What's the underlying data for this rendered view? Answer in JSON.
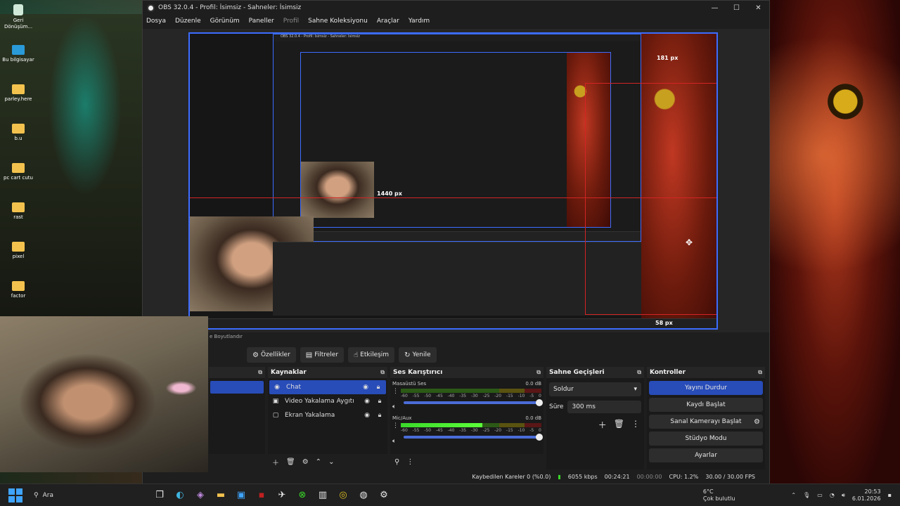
{
  "desktop": {
    "icons": [
      {
        "label": "Geri Dönüşüm...",
        "icon": "recycle-bin-icon"
      },
      {
        "label": "Bu bilgisayar",
        "icon": "computer-icon"
      },
      {
        "label": "parley.here",
        "icon": "folder-icon"
      },
      {
        "label": "b.u",
        "icon": "folder-icon"
      },
      {
        "label": "pc cart cutu",
        "icon": "folder-icon"
      },
      {
        "label": "rast",
        "icon": "folder-icon"
      },
      {
        "label": "pixel",
        "icon": "folder-icon"
      },
      {
        "label": "factor",
        "icon": "folder-icon"
      }
    ]
  },
  "window": {
    "title": "OBS 32.0.4 - Profil: İsimsiz - Sahneler: İsimsiz",
    "minimize": "—",
    "maximize": "☐",
    "close": "✕"
  },
  "menu": [
    "Dosya",
    "Düzenle",
    "Görünüm",
    "Paneller",
    "Profil",
    "Sahne Koleksiyonu",
    "Araçlar",
    "Yardım"
  ],
  "preview": {
    "width_label": "1440 px",
    "top_label": "181 px",
    "bottom_label": "58 px",
    "nested_title": "OBS 32.0.4 - Profil: İsimsiz - Sahneler: İsimsiz"
  },
  "scene_strip": "e Boyutlandır",
  "toolbar": {
    "properties": "Özellikler",
    "filters": "Filtreler",
    "interact": "Etkileşim",
    "refresh": "Yenile"
  },
  "sources": {
    "title": "Kaynaklar",
    "items": [
      {
        "name": "Chat",
        "icon": "browser-icon",
        "selected": true
      },
      {
        "name": "Video Yakalama Aygıtı",
        "icon": "camera-icon",
        "selected": false
      },
      {
        "name": "Ekran Yakalama",
        "icon": "monitor-icon",
        "selected": false
      }
    ]
  },
  "mixer": {
    "title": "Ses Karıştırıcı",
    "scale": [
      "-60",
      "-55",
      "-50",
      "-45",
      "-40",
      "-35",
      "-30",
      "-25",
      "-20",
      "-15",
      "-10",
      "-5",
      "0"
    ],
    "channels": [
      {
        "name": "Masaüstü Ses",
        "db": "0.0 dB",
        "level": 0,
        "volume": 1.0
      },
      {
        "name": "Mic/Aux",
        "db": "0.0 dB",
        "level": 0.58,
        "volume": 1.0
      }
    ]
  },
  "transitions": {
    "title": "Sahne Geçişleri",
    "selected": "Soldur",
    "duration_label": "Süre",
    "duration_value": "300 ms"
  },
  "controls": {
    "title": "Kontroller",
    "stop_stream": "Yayını Durdur",
    "start_recording": "Kaydı Başlat",
    "start_virtualcam": "Sanal Kamerayı Başlat",
    "studio_mode": "Stüdyo Modu",
    "settings": "Ayarlar"
  },
  "status": {
    "dropped_frames": "Kaybedilen Kareler 0 (%0.0)",
    "bitrate": "6055 kbps",
    "stream_time": "00:24:21",
    "rec_time": "00:00:00",
    "cpu": "CPU: 1.2%",
    "fps": "30.00 / 30.00 FPS"
  },
  "taskbar": {
    "search": "Ara",
    "weather_temp": "6°C",
    "weather_desc": "Çok bulutlu",
    "time": "20:53",
    "date": "6.01.2026"
  },
  "colors": {
    "accent": "#284cb8",
    "selection_border": "#3c6cff",
    "crop_line": "#d42424",
    "meter_green": "#3ad92a"
  }
}
